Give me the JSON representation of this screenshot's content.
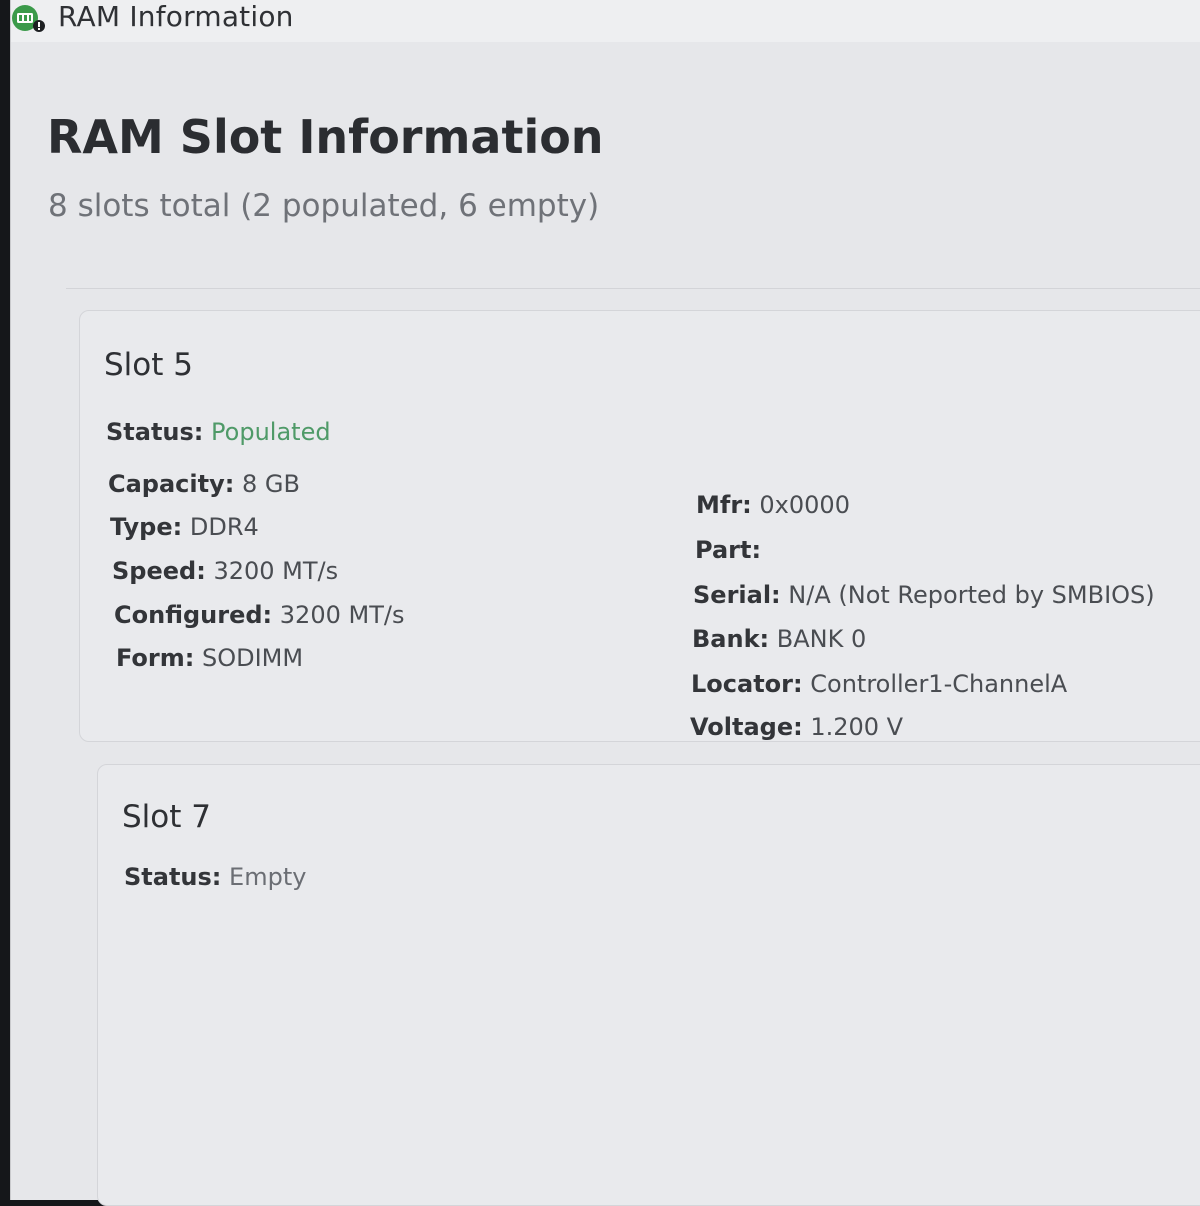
{
  "window": {
    "title": "RAM Information",
    "icon": "ram-chip-icon",
    "accent": "#3b9a4a"
  },
  "header": {
    "title": "RAM Slot Information",
    "subtitle": "8 slots total (2 populated, 6 empty)"
  },
  "slots": [
    {
      "title": "Slot 5",
      "status": {
        "label": "Status:",
        "value": "Populated",
        "color": "#4f9a68"
      },
      "left_fields": [
        {
          "label": "Capacity:",
          "value": "8 GB"
        },
        {
          "label": "Type:",
          "value": "DDR4"
        },
        {
          "label": "Speed:",
          "value": "3200 MT/s"
        },
        {
          "label": "Configured:",
          "value": "3200 MT/s"
        },
        {
          "label": "Form:",
          "value": "SODIMM"
        }
      ],
      "right_fields": [
        {
          "label": "Mfr:",
          "value": "0x0000"
        },
        {
          "label": "Part:",
          "value": ""
        },
        {
          "label": "Serial:",
          "value": "N/A (Not Reported by SMBIOS)"
        },
        {
          "label": "Bank:",
          "value": "BANK 0"
        },
        {
          "label": "Locator:",
          "value": "Controller1-ChannelA"
        },
        {
          "label": "Voltage:",
          "value": "1.200 V"
        }
      ]
    },
    {
      "title": "Slot 7",
      "status": {
        "label": "Status:",
        "value": "Empty",
        "color": "#6b6e74"
      }
    }
  ]
}
